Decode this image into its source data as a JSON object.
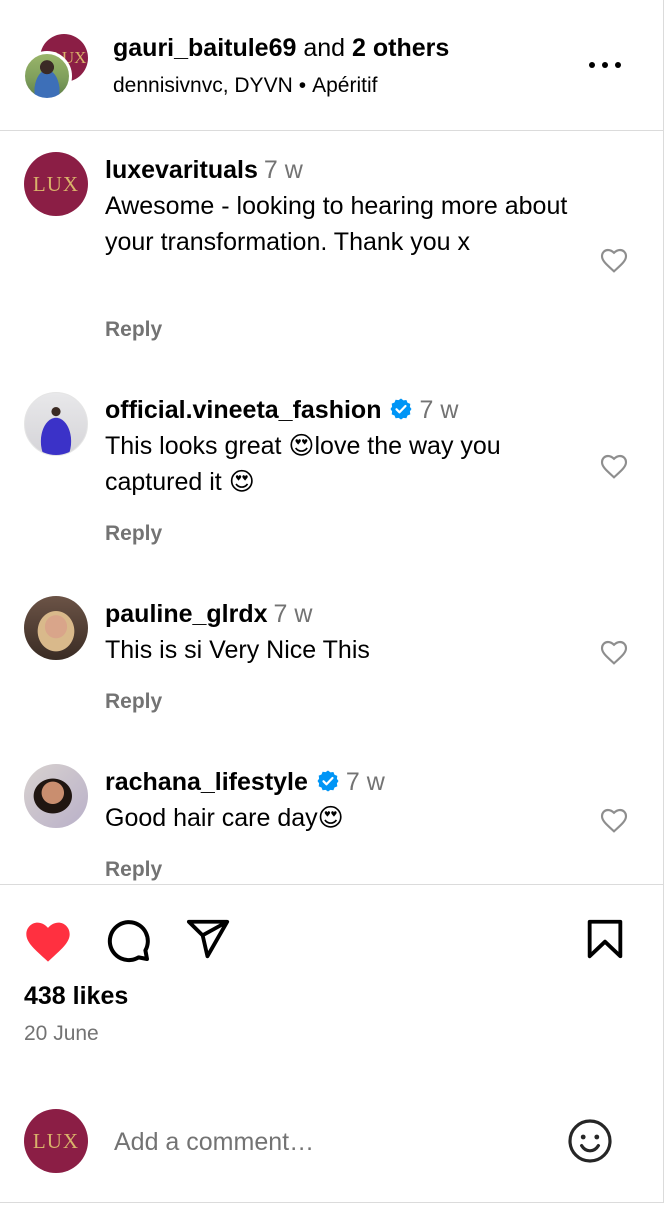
{
  "header": {
    "owner": "gauri_baitule69",
    "joiner": "and",
    "others": "2 others",
    "collaborators": "dennisivnvc, DYVN",
    "separator": "•",
    "audio": "Apéritif",
    "back_avatar_text": "LUX",
    "more_icon": "more-horizontal-icon"
  },
  "comments": [
    {
      "avatar_text": "LUX",
      "username": "luxevarituals",
      "verified": false,
      "time": "7 w",
      "text": "Awesome - looking to hearing more about your transformation. Thank you x",
      "reply_label": "Reply"
    },
    {
      "avatar_text": "",
      "username": "official.vineeta_fashion",
      "verified": true,
      "time": "7 w",
      "text_a": "This looks great ",
      "text_b": "love the way you captured it ",
      "emoji": "😍",
      "reply_label": "Reply"
    },
    {
      "avatar_text": "",
      "username": "pauline_glrdx",
      "verified": false,
      "time": "7 w",
      "text": "This is si Very Nice This",
      "reply_label": "Reply"
    },
    {
      "avatar_text": "",
      "username": "rachana_lifestyle",
      "verified": true,
      "time": "7 w",
      "text": "Good hair care day",
      "emoji": "😍",
      "reply_label": "Reply"
    }
  ],
  "actions": {
    "like_icon": "heart-filled-icon",
    "comment_icon": "comment-icon",
    "share_icon": "share-icon",
    "save_icon": "bookmark-icon",
    "likes": "438 likes",
    "date": "20 June"
  },
  "add_comment": {
    "avatar_text": "LUX",
    "placeholder": "Add a comment…",
    "emoji_icon": "emoji-smiley-icon"
  },
  "colors": {
    "like_red": "#ff3040",
    "verified_blue": "#0095f6",
    "muted_gray": "#737373",
    "divider": "#dbdbdb",
    "lux_burgundy": "#8b1e45",
    "lux_gold": "#d9b36a"
  }
}
